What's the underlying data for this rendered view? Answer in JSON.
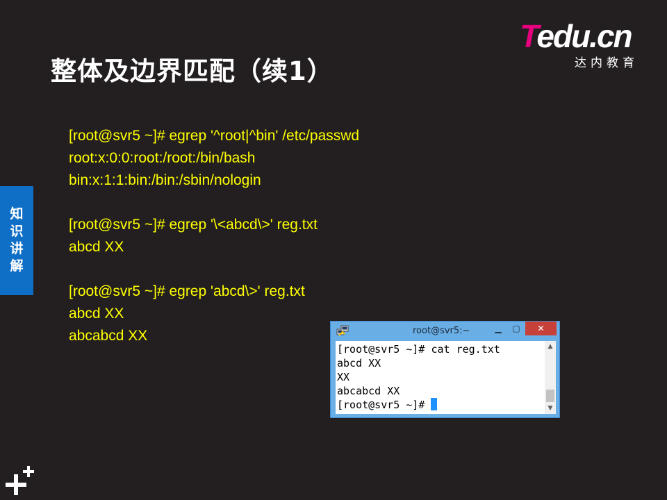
{
  "slide": {
    "title": "整体及边界匹配（续1）",
    "side_tab_label": "知\n识\n讲\n解"
  },
  "logo": {
    "brand_t": "T",
    "brand_rest": "edu.cn",
    "subtitle": "达内教育"
  },
  "code_lines": [
    "[root@svr5 ~]# egrep '^root|^bin' /etc/passwd",
    "root:x:0:0:root:/root:/bin/bash",
    "bin:x:1:1:bin:/bin:/sbin/nologin",
    "",
    "[root@svr5 ~]# egrep '\\<abcd\\>' reg.txt",
    "abcd XX",
    "",
    "[root@svr5 ~]# egrep 'abcd\\>' reg.txt",
    "abcd XX",
    "abcabcd XX"
  ],
  "terminal": {
    "title": "root@svr5:~",
    "lines": [
      "[root@svr5 ~]# cat reg.txt",
      "abcd XX",
      "XX",
      "abcabcd XX",
      "[root@svr5 ~]# "
    ],
    "minimize_glyph": "▁",
    "maximize_glyph": "▢",
    "close_glyph": "✕",
    "scroll_up_glyph": "▲",
    "scroll_down_glyph": "▼"
  },
  "colors": {
    "background": "#231f20",
    "code_text": "#ffff00",
    "side_tab": "#0f6fc6",
    "logo_accent": "#e6007e",
    "terminal_frame": "#6aaee6",
    "close_button": "#c7413a",
    "cursor": "#1e90ff"
  },
  "icons": {
    "terminal_app": "putty-icon",
    "corner": "plus-icon"
  }
}
